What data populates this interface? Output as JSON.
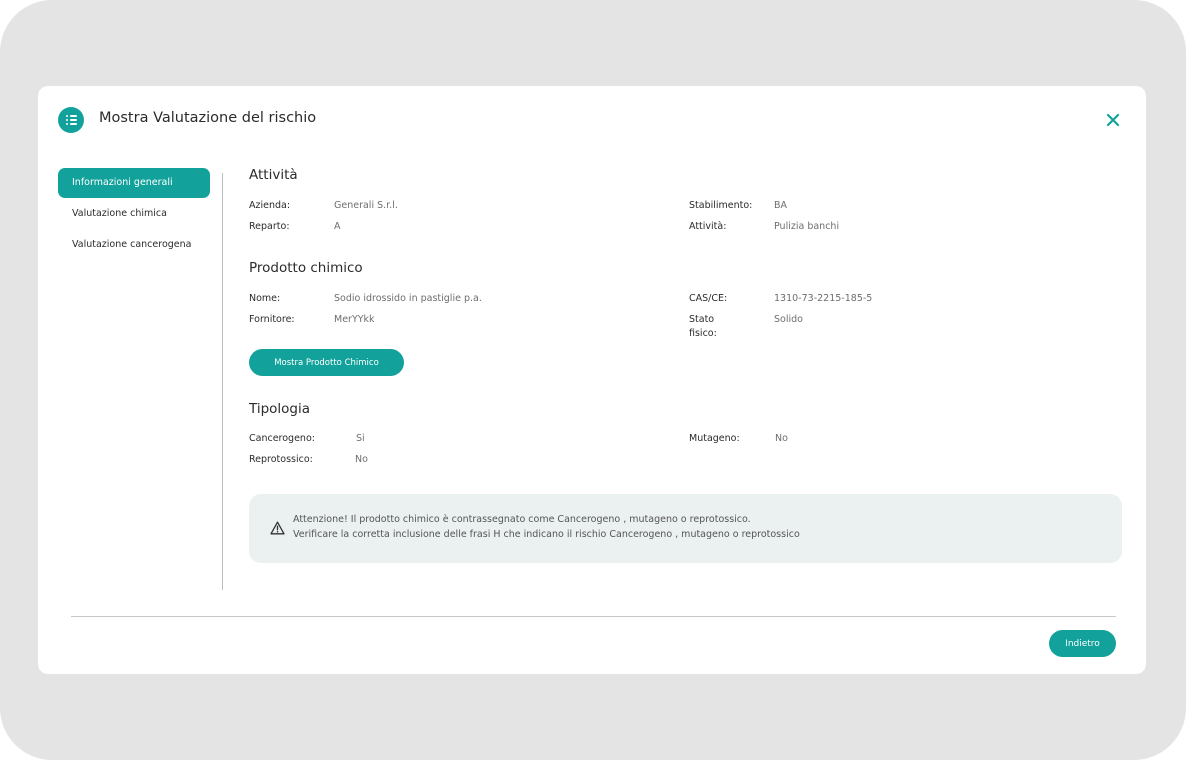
{
  "modal": {
    "title": "Mostra Valutazione del rischio",
    "header_icon": "list-icon",
    "close_icon": "close-icon"
  },
  "sidebar": {
    "items": [
      {
        "label": "Informazioni generali",
        "active": true
      },
      {
        "label": "Valutazione chimica",
        "active": false
      },
      {
        "label": "Valutazione cancerogena",
        "active": false
      }
    ]
  },
  "attivita": {
    "title": "Attività",
    "azienda_label": "Azienda:",
    "azienda_value": "Generali S.r.l.",
    "reparto_label": "Reparto:",
    "reparto_value": "A",
    "stabilimento_label": "Stabilimento:",
    "stabilimento_value": "BA",
    "attivita_label": "Attività:",
    "attivita_value": "Pulizia banchi"
  },
  "prodotto": {
    "title": "Prodotto chimico",
    "nome_label": "Nome:",
    "nome_value": "Sodio idrossido in pastiglie p.a.",
    "fornitore_label": "Fornitore:",
    "fornitore_value": "MerYYkk",
    "cas_label": "CAS/CE:",
    "cas_value": "1310-73-2215-185-5",
    "stato_label_1": "Stato",
    "stato_label_2": "fisico:",
    "stato_value": "Solido",
    "button_label": "Mostra Prodotto Chimico"
  },
  "tipologia": {
    "title": "Tipologia",
    "cancerogeno_label": "Cancerogeno:",
    "cancerogeno_value": "Si",
    "reprotossico_label": "Reprotossico:",
    "reprotossico_value": "No",
    "mutageno_label": "Mutageno:",
    "mutageno_value": "No"
  },
  "alert": {
    "icon": "warning-icon",
    "line1": "Attenzione! Il prodotto chimico è contrassegnato come Cancerogeno , mutageno o reprotossico.",
    "line2": "Verificare la corretta inclusione delle frasi H che indicano il rischio Cancerogeno , mutageno o reprotossico"
  },
  "footer": {
    "back_label": "Indietro"
  },
  "colors": {
    "accent": "#12a29b",
    "frame": "#e4e4e4",
    "alert_bg": "#ebf0f0"
  }
}
